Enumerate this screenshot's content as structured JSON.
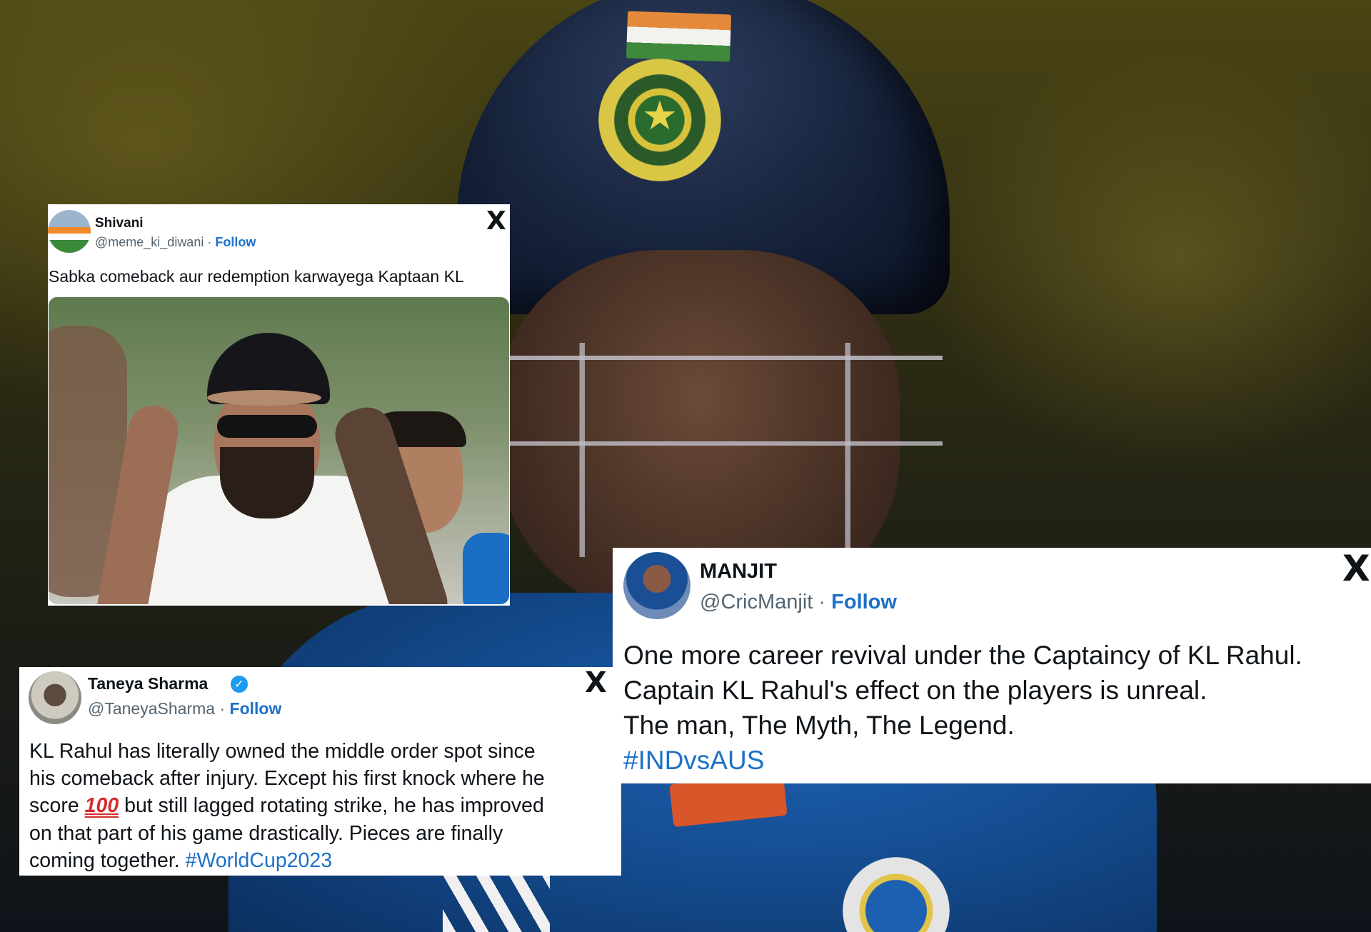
{
  "tweets": {
    "shivani": {
      "name": "Shivani",
      "handle": "@meme_ki_diwani",
      "separator": "·",
      "follow": "Follow",
      "x_logo": "X",
      "text": "Sabka comeback aur redemption karwayega Kaptaan KL"
    },
    "taneya": {
      "name": "Taneya Sharma",
      "verified": "✓",
      "handle": "@TaneyaSharma",
      "separator": "·",
      "follow": "Follow",
      "x_logo": "X",
      "line1": "KL Rahul has literally owned the middle order spot since",
      "line2": "his comeback after injury. Except his first knock where he",
      "line3_pre": "score",
      "line3_emoji": "100",
      "line3_post": "but still lagged rotating strike, he has improved",
      "line4": "on that part of his game drastically. Pieces are finally",
      "line5_pre": "coming together.",
      "hashtag": "#WorldCup2023"
    },
    "manjit": {
      "name": "MANJIT",
      "handle": "@CricManjit",
      "separator": "·",
      "follow": "Follow",
      "x_logo": "X",
      "line1": "One more career revival under the Captaincy of KL Rahul.",
      "line2": "Captain KL Rahul's effect on the players is unreal.",
      "line3": "The man, The Myth, The Legend.",
      "hashtag": "#INDvsAUS"
    }
  },
  "colors": {
    "link": "#1d70c8",
    "muted": "#536471",
    "verified": "#1d9bf0",
    "emoji_100": "#d42d2d"
  },
  "icons": [
    "x-logo-icon",
    "verified-badge-icon"
  ]
}
